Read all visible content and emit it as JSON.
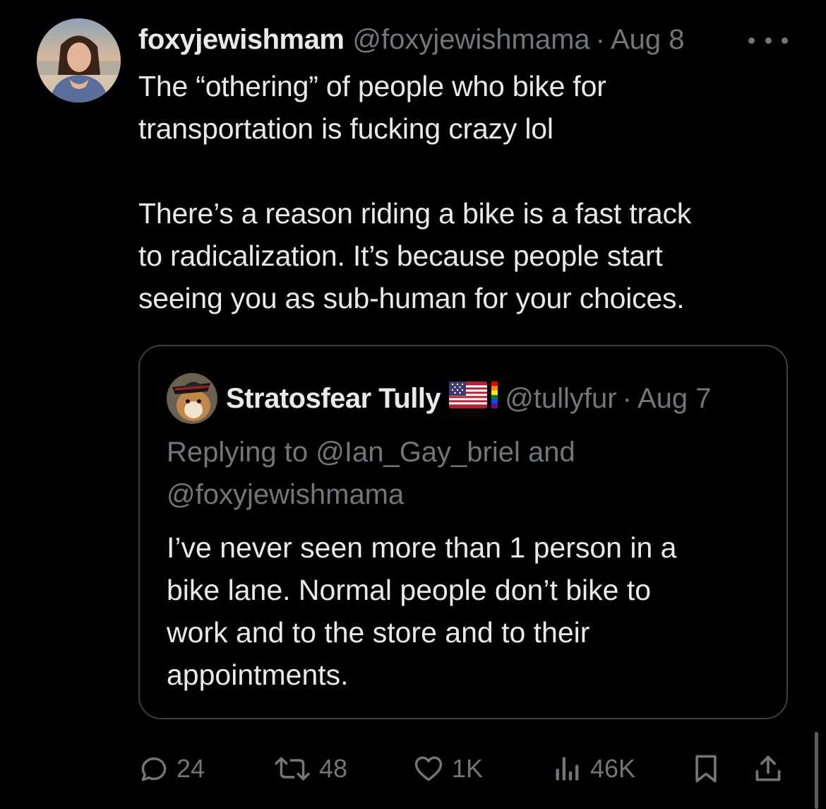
{
  "colors": {
    "background": "#000000",
    "primary_text": "#e7e9ea",
    "secondary_text": "#71767b",
    "quote_border": "#3d4043"
  },
  "post": {
    "author_name": "foxyjewishmam",
    "author_handle": "@foxyjewishmama",
    "separator": "·",
    "date": "Aug 8",
    "more_icon": "more-horizontal-icon",
    "text": "The “othering” of people who bike for\ntransportation is fucking crazy lol\n\nThere’s a reason riding a bike is a fast track\nto radicalization. It’s because people start\nseeing you as sub-human for your choices."
  },
  "quote": {
    "author_name": "Stratosfear Tully",
    "badges": [
      "us-flag-icon",
      "pride-flag-icon"
    ],
    "author_handle": "@tullyfur",
    "separator": "·",
    "date": "Aug 7",
    "replying_to": "Replying to @Ian_Gay_briel and @foxyjewishmama",
    "text": "I’ve never seen more than 1 person in a\nbike lane. Normal people don’t bike to\nwork and to the store and to their\nappointments."
  },
  "actions": {
    "replies": {
      "icon": "reply-icon",
      "count": "24"
    },
    "reposts": {
      "icon": "repost-icon",
      "count": "48"
    },
    "likes": {
      "icon": "heart-icon",
      "count": "1K"
    },
    "views": {
      "icon": "views-chart-icon",
      "count": "46K"
    },
    "bookmark": {
      "icon": "bookmark-icon"
    },
    "share": {
      "icon": "share-icon"
    }
  }
}
